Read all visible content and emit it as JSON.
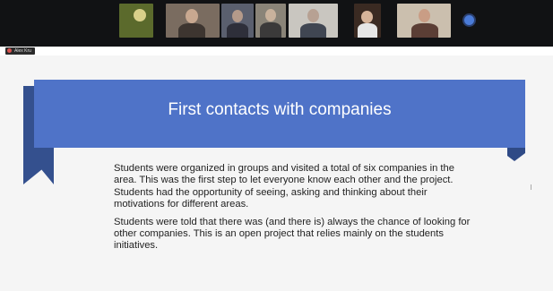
{
  "meeting": {
    "participant_tiles": [
      {
        "id": "p1",
        "bg": "#6b7a3a"
      },
      {
        "id": "p2",
        "bg": "#7a6c60"
      },
      {
        "id": "p3",
        "bg": "#5a5f6e"
      },
      {
        "id": "p4",
        "bg": "#8a8478"
      },
      {
        "id": "p5",
        "bg": "#c9c6c0"
      },
      {
        "id": "p6",
        "bg": "#3a2a22"
      },
      {
        "id": "p7",
        "bg": "#cbbfae"
      }
    ],
    "presenter_name": "Alex Kru"
  },
  "slide": {
    "title": "First contacts with companies",
    "paragraphs": [
      "Students were organized in groups and visited a total of six companies in the area. This was the first step to let everyone know each other and the project. Students had the opportunity of seeing, asking and thinking about their motivations for different areas.",
      "Students were told that there was (and there is) always the chance of looking for other companies. This is an open project that relies mainly on the students initiatives."
    ]
  },
  "colors": {
    "banner": "#4f73c8",
    "banner_fold": "#34508e",
    "strip_bg": "#111214",
    "accent_dot": "#4a7bd8"
  }
}
